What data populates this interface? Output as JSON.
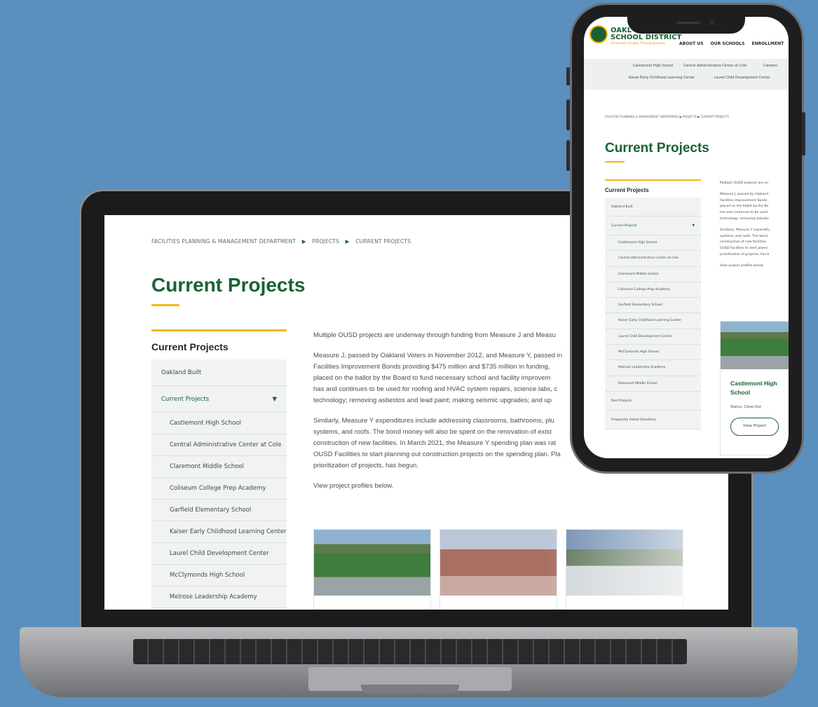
{
  "laptop": {
    "breadcrumb": [
      "FACILITIES PLANNING & MANAGEMENT DEPARTMENT",
      "PROJECTS",
      "CURRENT PROJECTS"
    ],
    "breadcrumb_separator": "▶",
    "page_title": "Current Projects",
    "sidebar": {
      "heading": "Current Projects",
      "items": [
        {
          "label": "Oakland Built"
        },
        {
          "label": "Current Projects",
          "expanded": true
        }
      ],
      "sub_items": [
        "Castlemont High School",
        "Central Administrative Center at Cole",
        "Claremont Middle School",
        "Coliseum College Prep Academy",
        "Garfield Elementary School",
        "Kaiser Early Childhood Learning Center",
        "Laurel Child Development Center",
        "McClymonds High School",
        "Melrose Leadership Academy"
      ]
    },
    "body": {
      "p1": "Multiple OUSD projects are underway through funding from Measure J and Measu",
      "p2_lines": [
        "Measure J, passed by Oakland Voters in November 2012, and Measure Y, passed in",
        "Facilities Improvement Bonds providing $475 million and $735 million in funding,",
        "placed on the ballot by the Board to fund necessary school and facility improvem",
        "has and continues to be used for roofing and HVAC system repairs, science labs, c",
        "technology; removing asbestos and lead paint; making seismic upgrades; and up"
      ],
      "p3_lines": [
        "Similarly, Measure Y expenditures include addressing classrooms, bathrooms, plu",
        "systems, and roofs. The bond money will also be spent on the renovation of exist",
        "construction of new facilities. In March 2021, the Measure Y spending plan was rat",
        "OUSD Facilities to start planning out construction projects on the spending plan. Pla",
        "prioritization of projects, has begun."
      ],
      "p4": "View project profiles below."
    }
  },
  "phone": {
    "logo": {
      "line1": "OAKL",
      "line2": "SCHOOL DISTRICT",
      "tagline": "Community Schools, Thriving Students"
    },
    "nav": [
      "ABOUT US",
      "OUR SCHOOLS",
      "ENROLLMENT"
    ],
    "subnav_row1": [
      "Castlemont High School",
      "Central Administrative Center at Cole",
      "Claremo"
    ],
    "subnav_row2": [
      "Kaiser Early Childhood Learning Center",
      "Laurel Child Development Center"
    ],
    "breadcrumb": [
      "FACILITIES PLANNING & MANAGEMENT DEPARTMENT",
      "PROJECTS",
      "CURRENT PROJECTS"
    ],
    "breadcrumb_separator": "▶",
    "page_title": "Current Projects",
    "sidebar": {
      "heading": "Current Projects",
      "items": [
        {
          "label": "Oakland Built"
        },
        {
          "label": "Current Projects",
          "expanded": true
        }
      ],
      "sub_items": [
        "Castlemont High School",
        "Central Administrative Center at Cole",
        "Claremont Middle School",
        "Coliseum College Prep Academy",
        "Garfield Elementary School",
        "Kaiser Early Childhood Learning Center",
        "Laurel Child Development Center",
        "McClymonds High School",
        "Melrose Leadership Academy",
        "Roosevelt Middle School"
      ],
      "bottom_items": [
        "Past Projects",
        "Frequently Asked Questions"
      ]
    },
    "body": {
      "p1": "Multiple OUSD projects are un",
      "p2_lines": [
        "Measure J, passed by Oakland",
        "Facilities Improvement Bonds",
        "placed on the ballot by the Bo",
        "has and continues to be used",
        "technology; removing asbesto"
      ],
      "p3_lines": [
        "Similarly, Measure Y expenditu",
        "systems, and roofs. The bond",
        "construction of new facilities.",
        "OUSD Facilities to start planni",
        "prioritization of projects, has b"
      ],
      "p4": "View project profiles below."
    },
    "card": {
      "title": "Castlemont High School",
      "status": "Status: Close-Out",
      "button": "View Project"
    }
  },
  "colors": {
    "brand_green": "#1a6236",
    "accent_gold": "#f1b80c",
    "background": "#5b8fbd"
  }
}
